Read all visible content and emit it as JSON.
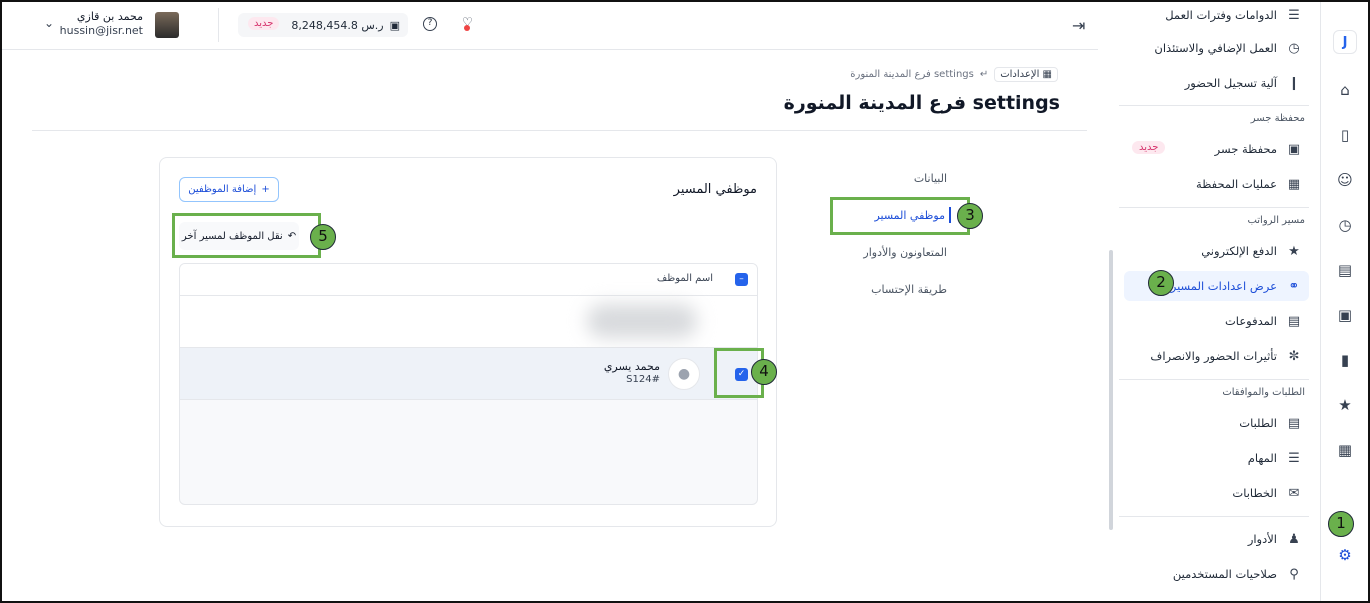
{
  "header": {
    "user_name": "محمد بن قازي",
    "user_email": "hussin@jisr.net",
    "wallet_badge": "جديد",
    "wallet_amount": "8,248,454.8 ر.س"
  },
  "breadcrumb": {
    "root": "الإعدادات",
    "current": "فرع المدينة المنورة settings"
  },
  "page_title": "فرع المدينة المنورة settings",
  "sidebar": {
    "items_top": [
      {
        "label": "الدوامات وفترات العمل"
      },
      {
        "label": "العمل الإضافي والاستئذان"
      },
      {
        "label": "آلية تسجيل الحضور"
      }
    ],
    "section_wallet": "محفظة جسر",
    "wallet_items": [
      {
        "label": "محفظة جسر",
        "badge": "جديد"
      },
      {
        "label": "عمليات المحفظة"
      }
    ],
    "section_payroll": "مسير الرواتب",
    "payroll_items": [
      {
        "label": "الدفع الإلكتروني"
      },
      {
        "label": "عرض اعدادات المسير"
      },
      {
        "label": "المدفوعات"
      },
      {
        "label": "تأثيرات الحضور والانصراف"
      }
    ],
    "section_requests": "الطلبات والموافقات",
    "request_items": [
      {
        "label": "الطلبات"
      },
      {
        "label": "المهام"
      },
      {
        "label": "الخطابات"
      }
    ],
    "bottom_items": [
      {
        "label": "الأدوار"
      },
      {
        "label": "صلاحيات المستخدمين"
      }
    ]
  },
  "settings_nav": [
    {
      "label": "البيانات"
    },
    {
      "label": "موظفي المسير"
    },
    {
      "label": "المتعاونون والأدوار"
    },
    {
      "label": "طريقة الإحتساب"
    }
  ],
  "card": {
    "title": "موظفي المسير",
    "add_button": "إضافة الموظفين",
    "move_button": "نقل الموظف لمسير آخر",
    "column_header": "اسم الموظف",
    "employee": {
      "name": "محمد يسري",
      "code": "S124#"
    }
  },
  "steps": [
    "1",
    "2",
    "3",
    "4",
    "5"
  ],
  "colors": {
    "accent": "#2563eb",
    "step_green": "#6ab04c",
    "badge_pink": "#d6336c"
  }
}
